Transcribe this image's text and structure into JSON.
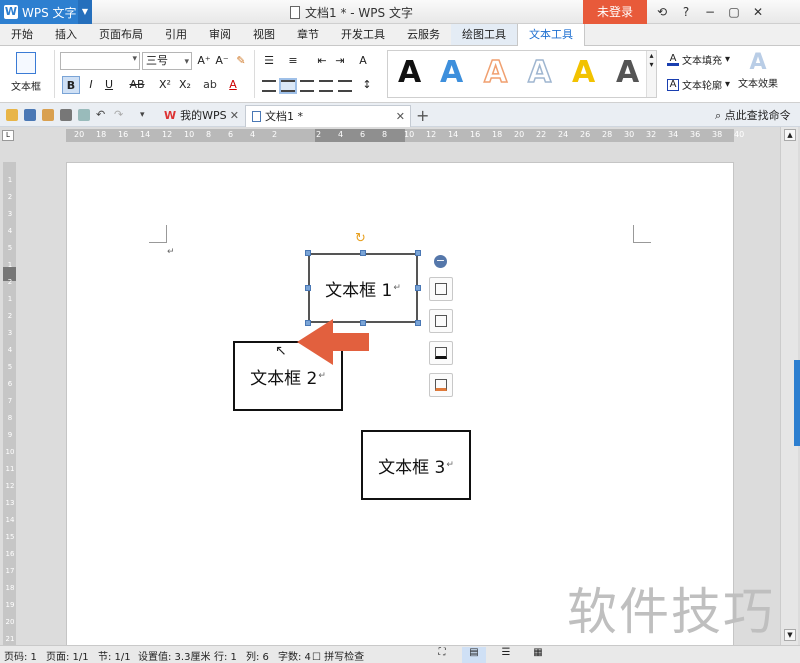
{
  "app": {
    "name": "WPS 文字",
    "window_title": "文档1 * - WPS 文字",
    "login_label": "未登录",
    "window_controls": [
      "⟲",
      "?",
      "−",
      "▢",
      "✕"
    ]
  },
  "menu_tabs": [
    "开始",
    "插入",
    "页面布局",
    "引用",
    "审阅",
    "视图",
    "章节",
    "开发工具",
    "云服务",
    "绘图工具",
    "文本工具"
  ],
  "active_tab": "文本工具",
  "ribbon": {
    "textbox_label": "文本框",
    "font_name": "",
    "font_size": "三号",
    "bold": "B",
    "italic": "I",
    "underline": "U",
    "strike": "AB",
    "superscript": "X²",
    "subscript": "X₂",
    "grow_font": "A⁺",
    "shrink_font": "A⁻",
    "text_fill_label": "文本填充",
    "text_outline_label": "文本轮廓",
    "text_effect_label": "文本效果",
    "style_samples": [
      {
        "glyph": "A",
        "color": "#111111"
      },
      {
        "glyph": "A",
        "color": "#3d8fdc"
      },
      {
        "glyph": "A",
        "color": "#f0a070"
      },
      {
        "glyph": "A",
        "color": "#b6c8dc"
      },
      {
        "glyph": "A",
        "color": "#f2c200"
      },
      {
        "glyph": "A",
        "color": "#555555"
      }
    ]
  },
  "doc_tabs": {
    "mywps": "我的WPS",
    "current": "文档1 *",
    "find_command": "点此查找命令"
  },
  "ruler": {
    "h_ticks": [
      "20",
      "18",
      "16",
      "14",
      "12",
      "10",
      "8",
      "6",
      "4",
      "2",
      "",
      "2",
      "4",
      "6",
      "8",
      "10",
      "12",
      "14",
      "16",
      "18",
      "20",
      "22",
      "24",
      "26",
      "28",
      "30",
      "32",
      "34",
      "36",
      "38",
      "40"
    ],
    "v_ticks": [
      "1",
      "2",
      "3",
      "4",
      "5",
      "1",
      "2",
      "1",
      "2",
      "3",
      "4",
      "5",
      "6",
      "7",
      "8",
      "9",
      "10",
      "11",
      "12",
      "13",
      "14",
      "15",
      "16",
      "17",
      "18",
      "19",
      "20",
      "21"
    ]
  },
  "document": {
    "textbox1": "文本框 1",
    "textbox2": "文本框 2",
    "textbox3": "文本框 3",
    "paragraph_mark": "↵",
    "watermark": "软件技巧"
  },
  "status": {
    "page_code": "页码: 1",
    "page": "页面: 1/1",
    "section": "节: 1/1",
    "setting": "设置值: 3.3厘米",
    "row": "行: 1",
    "col": "列: 6",
    "words": "字数: 4",
    "spellcheck": "拼写检查"
  },
  "colors": {
    "accent": "#2d7fd0",
    "login": "#e85a3a",
    "arrow": "#e2603e"
  }
}
